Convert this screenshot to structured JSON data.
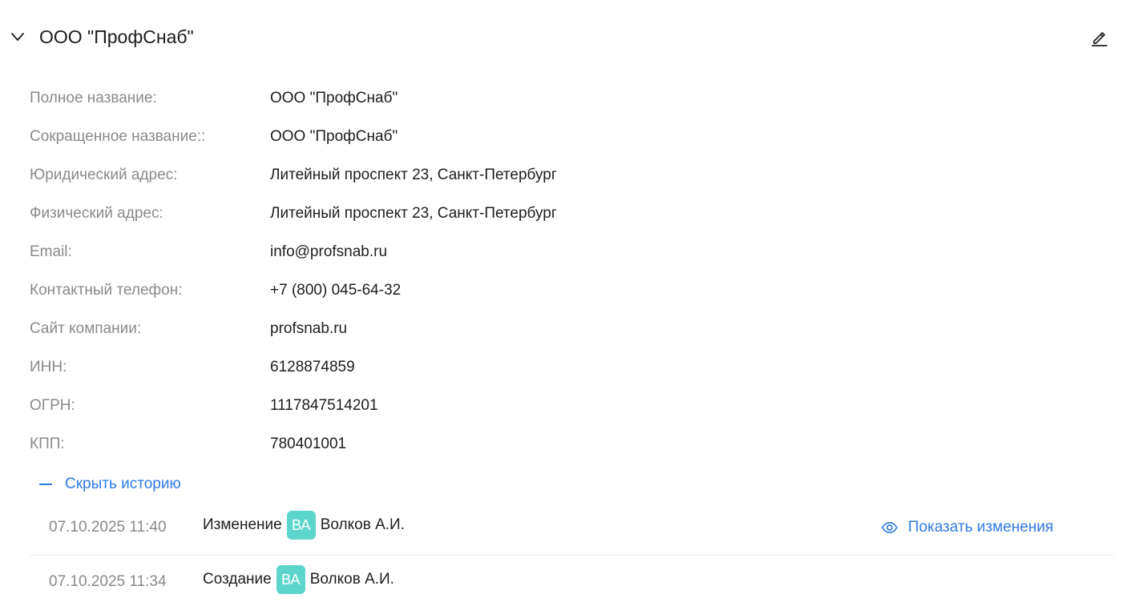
{
  "header": {
    "title": "ООО \"ПрофСнаб\"",
    "collapse_icon": "chevron-down-icon",
    "edit_icon": "pencil-icon"
  },
  "fields": [
    {
      "label": "Полное название:",
      "value": "ООО \"ПрофСнаб\""
    },
    {
      "label": "Сокращенное название::",
      "value": "ООО \"ПрофСнаб\""
    },
    {
      "label": "Юридический адрес:",
      "value": "Литейный проспект 23, Санкт-Петербург"
    },
    {
      "label": "Физический адрес:",
      "value": "Литейный проспект 23, Санкт-Петербург"
    },
    {
      "label": "Email:",
      "value": "info@profsnab.ru"
    },
    {
      "label": "Контактный телефон:",
      "value": "+7 (800) 045-64-32"
    },
    {
      "label": "Сайт компании:",
      "value": "profsnab.ru"
    },
    {
      "label": "ИНН:",
      "value": "6128874859"
    },
    {
      "label": "ОГРН:",
      "value": "1117847514201"
    },
    {
      "label": "КПП:",
      "value": "780401001"
    }
  ],
  "history": {
    "toggle_label": "Скрыть историю",
    "toggle_icon": "minus-icon",
    "entries": [
      {
        "date": "07.10.2025 11:40",
        "action": "Изменение",
        "avatar_initials": "ВА",
        "user": "Волков А.И.",
        "show_changes_label": "Показать изменения",
        "show_changes_icon": "eye-icon"
      },
      {
        "date": "07.10.2025 11:34",
        "action": "Создание",
        "avatar_initials": "ВА",
        "user": "Волков А.И."
      }
    ]
  },
  "colors": {
    "accent": "#2e7be6",
    "label": "#8a8a8a",
    "text": "#1e1e1e",
    "avatar_bg": "#5cd6cd"
  }
}
